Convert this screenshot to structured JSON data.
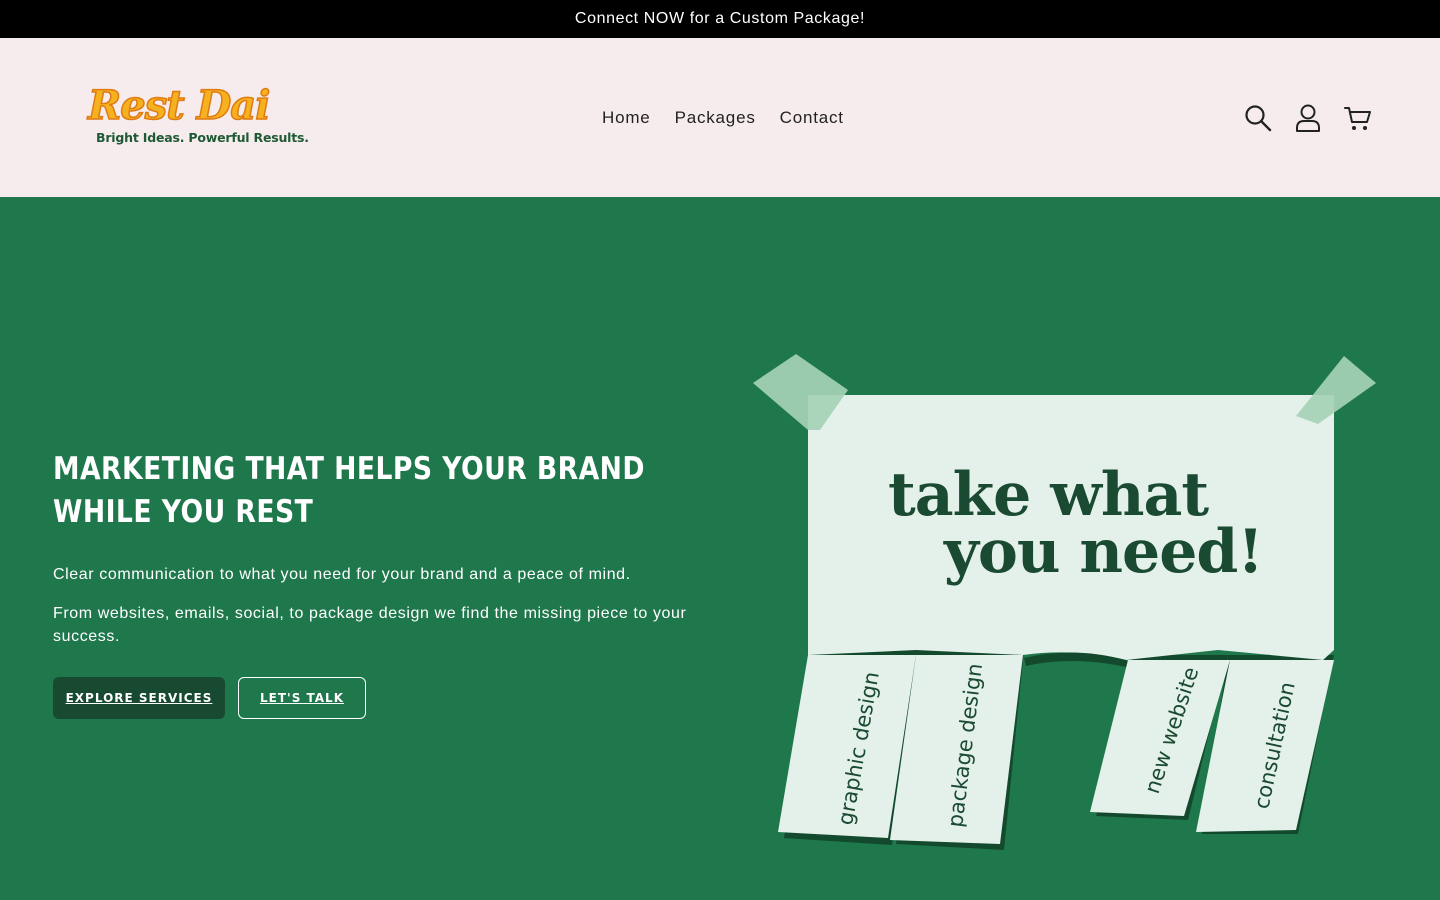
{
  "announcement": {
    "text": "Connect NOW for a Custom Package!"
  },
  "brand": {
    "name": "Rest Dai",
    "tagline": "Bright Ideas. Powerful Results."
  },
  "nav": {
    "items": [
      {
        "label": "Home"
      },
      {
        "label": "Packages"
      },
      {
        "label": "Contact"
      }
    ]
  },
  "header_icons": [
    "search-icon",
    "account-icon",
    "cart-icon"
  ],
  "hero": {
    "title": "Marketing that helps your brand while you rest",
    "paragraph_1": "Clear communication to what you need for your brand and a peace of mind.",
    "paragraph_2": "From websites, emails, social, to package design we find the missing piece to your success.",
    "button_primary": "Explore Services",
    "button_secondary": "Let's Talk"
  },
  "illustration": {
    "headline_line_1": "take what",
    "headline_line_2": "you need!",
    "tabs": [
      "graphic design",
      "package design",
      "new website",
      "consultation"
    ]
  },
  "colors": {
    "hero_bg": "#1f774c",
    "header_bg": "#f6ecee",
    "announce_bg": "#000000",
    "primary_button": "#174a30",
    "logo_orange": "#f6b21e",
    "note_paper": "#e4f1ea",
    "note_text": "#1a4a31"
  }
}
